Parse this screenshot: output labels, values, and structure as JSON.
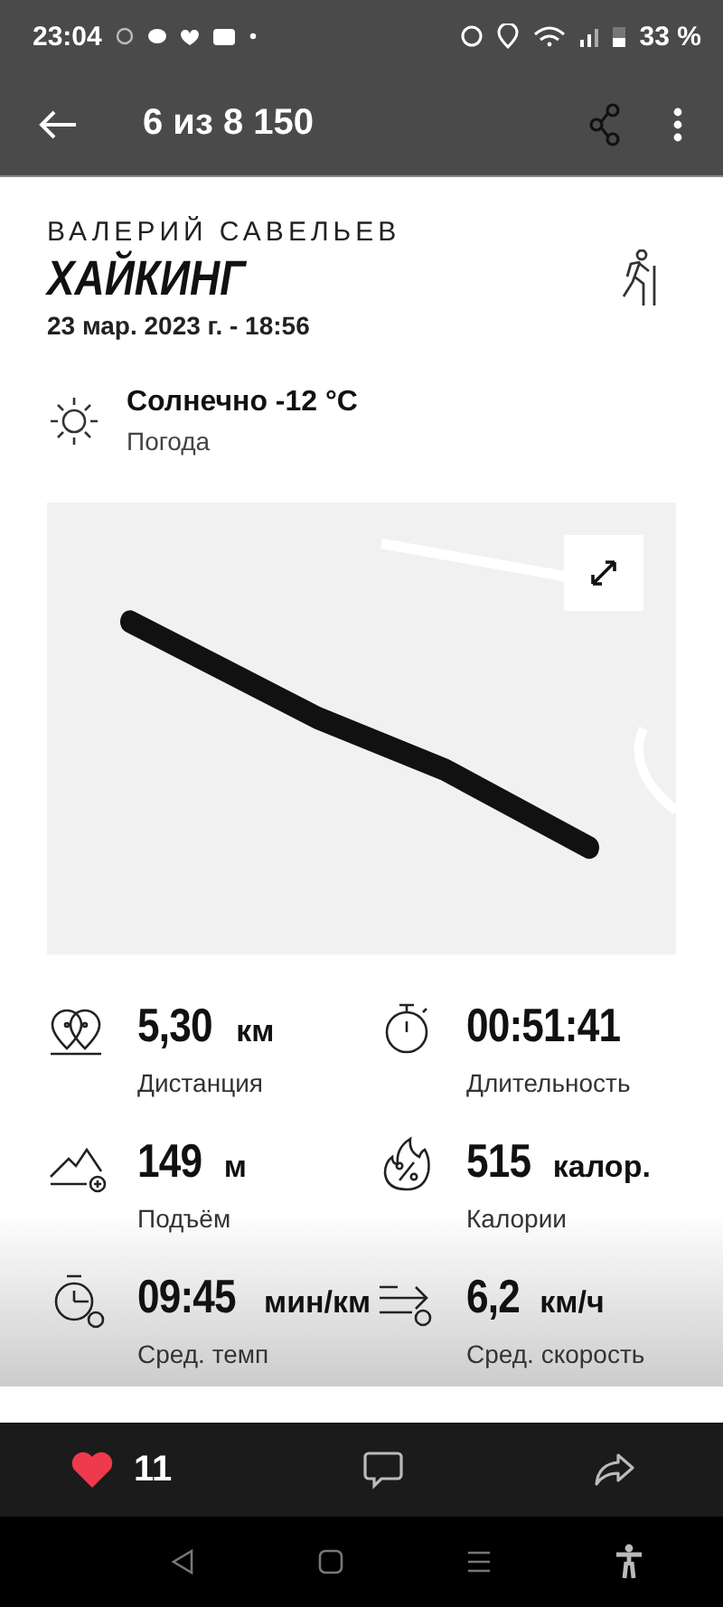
{
  "status_bar": {
    "time": "23:04",
    "battery": "33 %"
  },
  "app_bar": {
    "title": "6 из 8 150"
  },
  "activity": {
    "athlete": "ВАЛЕРИЙ САВЕЛЬЕВ",
    "type": "ХАЙКИНГ",
    "datetime": "23 мар. 2023 г. - 18:56"
  },
  "weather": {
    "value": "Солнечно -12 °C",
    "label": "Погода"
  },
  "stats": [
    {
      "kind": "distance",
      "value": "5,30",
      "unit": "км",
      "label": "Дистанция"
    },
    {
      "kind": "duration",
      "value": "00:51:41",
      "label": "Длительность"
    },
    {
      "kind": "ascent",
      "value": "149",
      "unit": "м",
      "label": "Подъём"
    },
    {
      "kind": "calories",
      "value": "515",
      "unit": "калор.",
      "label": "Калории"
    },
    {
      "kind": "pace",
      "value": "09:45",
      "unit": "мин/км",
      "label": "Сред. темп"
    },
    {
      "kind": "speed",
      "value": "6,2",
      "unit": "км/ч",
      "label": "Сред. скорость"
    }
  ],
  "actions": {
    "likes": "11"
  }
}
